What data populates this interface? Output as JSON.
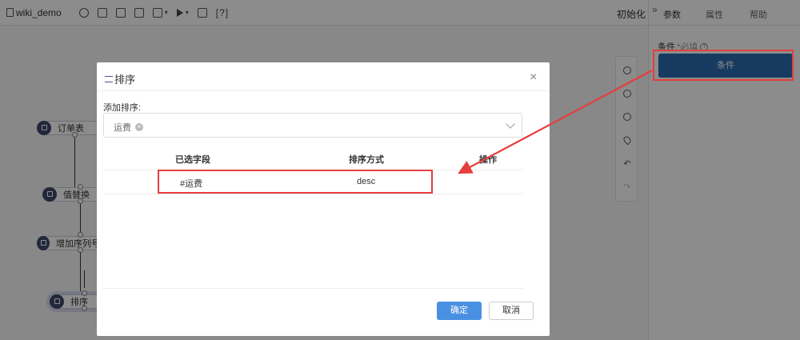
{
  "toolbar": {
    "project_name": "wiki_demo",
    "tool_icons": [
      "run-settings-icon",
      "edit-doc-icon",
      "save-icon",
      "export-icon",
      "layout-icon",
      "play-icon",
      "schedule-icon"
    ],
    "help_label": "[?]",
    "init_label": "初始化"
  },
  "right_panel": {
    "collapse_glyph": "»",
    "tabs": [
      "参数",
      "属性",
      "帮助"
    ],
    "active_tab": "参数",
    "condition_label": "条件",
    "condition_required": "*必填",
    "condition_help_glyph": "?",
    "condition_button": "条件"
  },
  "canvas": {
    "nodes": [
      {
        "label": "订单表"
      },
      {
        "label": "值替换"
      },
      {
        "label": "增加序列号"
      },
      {
        "label": "排序"
      }
    ]
  },
  "modal": {
    "title": "排序",
    "close_glyph": "×",
    "add_sort_label": "添加排序:",
    "selected_tag": "运费",
    "tag_remove_glyph": "×",
    "columns": [
      "已选字段",
      "排序方式",
      "操作"
    ],
    "rows": [
      {
        "field": "#运费",
        "order": "desc"
      }
    ],
    "ok_label": "确定",
    "cancel_label": "取消"
  },
  "colors": {
    "primary": "#2b6cb0",
    "ok_button": "#4a90e2",
    "highlight": "#e53e3e"
  }
}
